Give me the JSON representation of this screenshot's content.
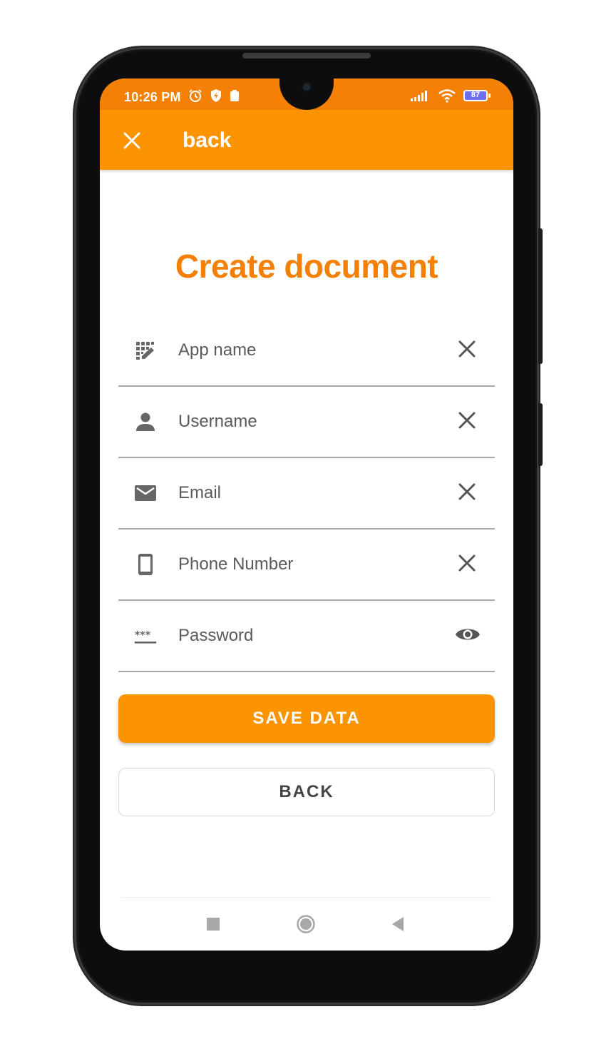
{
  "status_bar": {
    "time": "10:26 PM",
    "left_icons": [
      "alarm-icon",
      "shield-icon",
      "clipboard-icon"
    ],
    "right_icons": [
      "signal-icon",
      "wifi-icon",
      "battery-icon"
    ],
    "battery": "87"
  },
  "app_bar": {
    "close_icon": "close-icon",
    "title": "back",
    "background": "#fb9400"
  },
  "form": {
    "title": "Create document",
    "title_color": "#f48106",
    "fields": [
      {
        "label": "App name",
        "icon": "dialpad-edit-icon",
        "trailing_icon": "clear-icon"
      },
      {
        "label": "Username",
        "icon": "person-icon",
        "trailing_icon": "clear-icon"
      },
      {
        "label": "Email",
        "icon": "email-icon",
        "trailing_icon": "clear-icon"
      },
      {
        "label": "Phone Number",
        "icon": "phone-icon",
        "trailing_icon": "clear-icon"
      },
      {
        "label": "Password",
        "icon": "password-icon",
        "trailing_icon": "visibility-icon"
      }
    ]
  },
  "buttons": {
    "save_label": "SAVE DATA",
    "back_label": "BACK",
    "primary_color": "#fb9400"
  },
  "nav_bar": {
    "icons": [
      "recents-icon",
      "home-icon",
      "back-icon"
    ]
  }
}
